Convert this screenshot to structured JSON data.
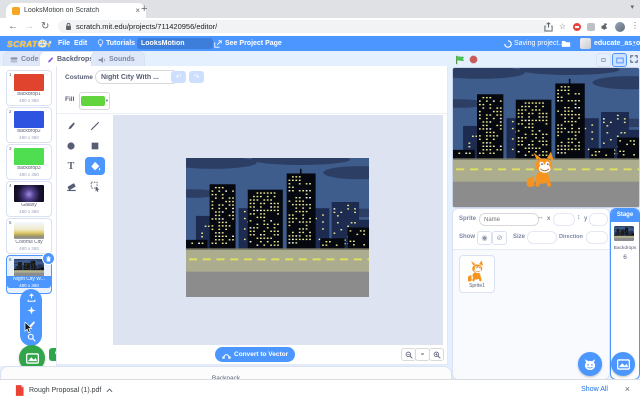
{
  "colors": {
    "accent": "#4C97FF",
    "green": "#31A549",
    "fill_swatch": "#62D53E",
    "logo_orange": "#FFBE2E"
  },
  "browser": {
    "tab_title": "LooksMotion on Scratch",
    "url": "scratch.mit.edu/projects/711420956/editor/",
    "download_file": "Rough Proposal (1).pdf",
    "show_all": "Show All"
  },
  "header": {
    "logo": "SCRATCH",
    "file": "File",
    "edit": "Edit",
    "tutorials": "Tutorials",
    "project_name": "LooksMotion",
    "see_project_page": "See Project Page",
    "saving": "Saving project...",
    "username": "educate_as_one"
  },
  "tabs": {
    "code": "Code",
    "backdrops": "Backdrops",
    "sounds": "Sounds"
  },
  "backdrops": [
    {
      "num": "1",
      "name": "backdrop1",
      "size": "480 x 360"
    },
    {
      "num": "2",
      "name": "backdrop2",
      "size": "480 x 360"
    },
    {
      "num": "3",
      "name": "backdrop3",
      "size": "480 x 360"
    },
    {
      "num": "4",
      "name": "Galaxy",
      "size": "480 x 360"
    },
    {
      "num": "5",
      "name": "Colorful City",
      "size": "480 x 360"
    },
    {
      "num": "6",
      "name": "Night City W...",
      "size": "480 x 360"
    }
  ],
  "paint": {
    "costume_label": "Costume",
    "costume_name": "Night City With ...",
    "fill_label": "Fill",
    "convert_to_vector": "Convert to Vector",
    "choose_backdrop": "Choose a Backdrop",
    "zoom_reset": "="
  },
  "sprite_panel": {
    "sprite": "Sprite",
    "name_placeholder": "Name",
    "x": "x",
    "y": "y",
    "show": "Show",
    "size": "Size",
    "direction": "Direction",
    "sprite1": "Sprite1"
  },
  "stage_panel": {
    "title": "Stage",
    "backdrops_label": "Backdrops",
    "count": "6"
  },
  "backpack_label": "Backpack"
}
